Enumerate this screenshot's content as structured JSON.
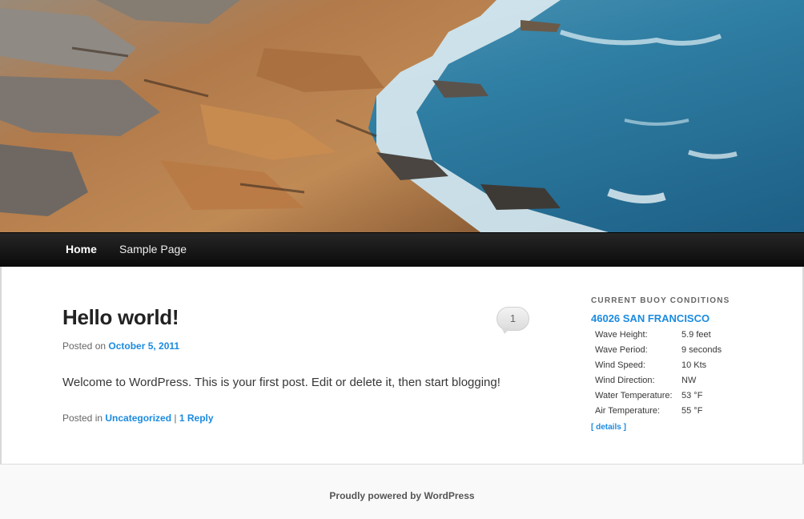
{
  "header": {
    "image_alt": "Rocky coastline with ocean waves"
  },
  "nav": {
    "items": [
      {
        "label": "Home",
        "current": true
      },
      {
        "label": "Sample Page",
        "current": false
      }
    ]
  },
  "post": {
    "title": "Hello world!",
    "posted_on_prefix": "Posted on ",
    "date": "October 5, 2011",
    "content": "Welcome to WordPress. This is your first post. Edit or delete it, then start blogging!",
    "posted_in_prefix": "Posted in ",
    "category": "Uncategorized",
    "separator": "|",
    "reply_label": "1 Reply",
    "comment_count": "1"
  },
  "widget": {
    "title": "CURRENT BUOY CONDITIONS",
    "station": "46026 SAN FRANCISCO",
    "rows": [
      {
        "label": "Wave Height:",
        "value": "5.9 feet"
      },
      {
        "label": "Wave Period:",
        "value": "9 seconds"
      },
      {
        "label": "Wind Speed:",
        "value": "10 Kts"
      },
      {
        "label": "Wind Direction:",
        "value": "NW"
      },
      {
        "label": "Water Temperature:",
        "value": "53 °F"
      },
      {
        "label": "Air Temperature:",
        "value": "55 °F"
      }
    ],
    "details_label": "[ details ]"
  },
  "footer": {
    "credit": "Proudly powered by WordPress"
  },
  "colors": {
    "link": "#1b8be0",
    "nav_bg": "#0a0a0a"
  }
}
